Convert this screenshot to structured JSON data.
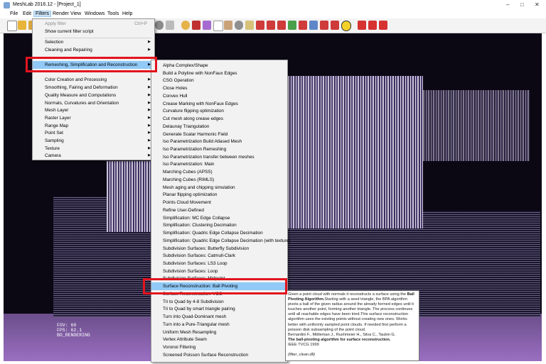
{
  "window": {
    "title": "MeshLab 2016.12 - [Project_1]"
  },
  "menubar": [
    "File",
    "Edit",
    "Filters",
    "Render",
    "View",
    "Windows",
    "Tools",
    "Help"
  ],
  "filters_menu": {
    "apply_filter": "Apply filter",
    "apply_filter_shortcut": "Ctrl+P",
    "show_script": "Show current filter script",
    "items": [
      "Selection",
      "Cleaning and Repairing",
      "Remeshing, Simplification and Reconstruction",
      "Color Creation and Processing",
      "Smoothing, Fairing and Deformation",
      "Quality Measure and Computations",
      "Normals, Curvatures and Orientation",
      "Mesh Layer",
      "Raster Layer",
      "Range Map",
      "Point Set",
      "Sampling",
      "Texture",
      "Camera"
    ]
  },
  "submenu": {
    "items": [
      "Alpha Complex/Shape",
      "Build a Polyline with NonFaux Edges",
      "CSG Operation",
      "Close Holes",
      "Convex Hull",
      "Crease Marking with NonFaux Edges",
      "Curvature flipping optimization",
      "Cut mesh along crease edges",
      "Delaunay Triangulation",
      "Generate Scalar Harmonic Field",
      "Iso Parametrization Build Atlased Mesh",
      "Iso Parametrization Remeshing",
      "Iso Parametrization transfer between meshes",
      "Iso Parametrization: Main",
      "Marching Cubes (APSS)",
      "Marching Cubes (RIMLS)",
      "Mesh aging and chipping simulation",
      "Planar flipping optimization",
      "Points Cloud Movement",
      "Refine User-Defined",
      "Simplification: MC Edge Collapse",
      "Simplification: Clustering Decimation",
      "Simplification: Quadric Edge Collapse Decimation",
      "Simplification: Quadric Edge Collapse Decimation (with texture)",
      "Subdivision Surfaces: Butterfly Subdivision",
      "Subdivision Surfaces: Catmull-Clark",
      "Subdivision Surfaces: LS3 Loop",
      "Subdivision Surfaces: Loop",
      "Subdivision Surfaces: Midpoint",
      "Surface Reconstruction: Ball Pivoting",
      "Surface Reconstruction: VCG",
      "Tri to Quad by 4-8 Subdivision",
      "Tri to Quad by smart triangle pairing",
      "Turn into Quad-Dominant mesh",
      "Turn into a Pure-Triangular mesh",
      "Uniform Mesh Resampling",
      "Vertex Attribute Seam",
      "Voronoi Filtering",
      "Screened Poisson Surface Reconstruction"
    ]
  },
  "tooltip": {
    "intro": "Given a point cloud with normals it reconstructs a surface using the ",
    "bold_name": "Ball Pivoting Algorithm.",
    "body": "Starting with a seed triangle, the BPA algorithm pivots a ball of the given radius around the already formed edges until it touches another point, forming another triangle. The process continues until all reachable edges have been tried.This surface reconstruction algorithm uses the existing points without creating new ones. Works better with uniformly sampled point clouds. If needed first perform a poisson disk subsampling of the point cloud.",
    "authors": "Bernardini F., Mittleman J., Rushmeier H., Silva C., Taubin G.",
    "paper": "The ball-pivoting algorithm for surface reconstruction.",
    "venue": "IEEE TVCG 1999",
    "plugin": "(filter_clean.dll)"
  },
  "viewport_info": {
    "fov": "FOV: 60",
    "fps": "FPS:    62.1",
    "mode": "BO_RENDERING"
  }
}
